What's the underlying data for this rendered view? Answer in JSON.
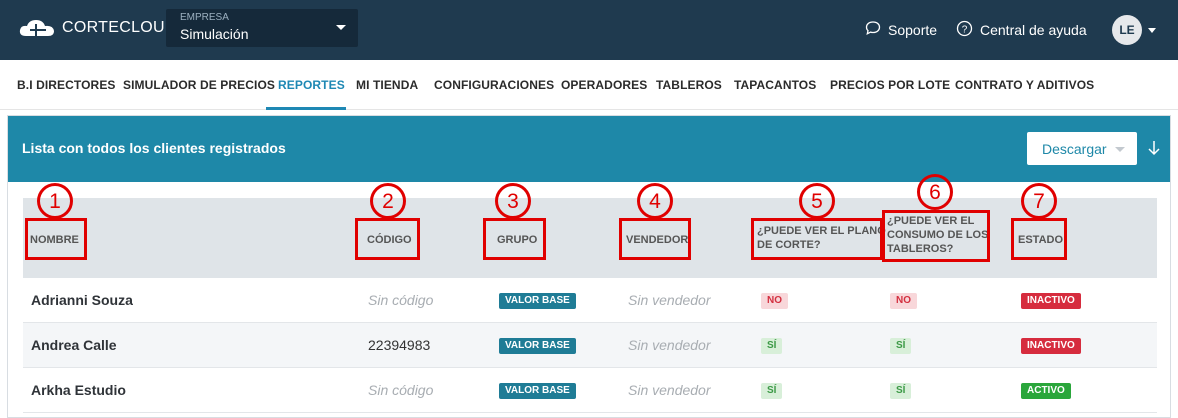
{
  "topbar": {
    "logo_text": "CORTECLOUD",
    "empresa_label": "EMPRESA",
    "empresa_value": "Simulación",
    "support_label": "Soporte",
    "help_label": "Central de ayuda",
    "avatar_initials": "LE"
  },
  "nav": {
    "items": [
      "B.I DIRECTORES",
      "SIMULADOR DE PRECIOS",
      "REPORTES",
      "MI TIENDA",
      "CONFIGURACIONES",
      "OPERADORES",
      "TABLEROS",
      "TAPACANTOS",
      "PRECIOS POR LOTE",
      "CONTRATO Y ADITIVOS"
    ],
    "active": "REPORTES"
  },
  "card": {
    "title": "Lista con todos los clientes registrados",
    "download_label": "Descargar"
  },
  "table": {
    "headers": [
      "NOMBRE",
      "CÓDIGO",
      "GRUPO",
      "VENDEDOR",
      "¿PUEDE VER EL PLANO DE CORTE?",
      "¿PUEDE VER EL CONSUMO DE LOS TABLEROS?",
      "ESTADO"
    ],
    "rows": [
      {
        "nombre": "Adrianni Souza",
        "codigo": "Sin código",
        "grupo": "VALOR BASE",
        "vendedor": "Sin vendedor",
        "plano": "NO",
        "consumo": "NO",
        "estado": "INACTIVO"
      },
      {
        "nombre": "Andrea Calle",
        "codigo": "22394983",
        "grupo": "VALOR BASE",
        "vendedor": "Sin vendedor",
        "plano": "SÍ",
        "consumo": "SÍ",
        "estado": "INACTIVO"
      },
      {
        "nombre": "Arkha Estudio",
        "codigo": "Sin código",
        "grupo": "VALOR BASE",
        "vendedor": "Sin vendedor",
        "plano": "SÍ",
        "consumo": "SÍ",
        "estado": "ACTIVO"
      }
    ]
  },
  "annotations": [
    "1",
    "2",
    "3",
    "4",
    "5",
    "6",
    "7"
  ],
  "colors": {
    "topbar": "#1f3a4f",
    "accent": "#1e88a8",
    "annotation": "#e00000",
    "active_badge": "#2aa63b",
    "inactive_badge": "#d62c3e"
  }
}
